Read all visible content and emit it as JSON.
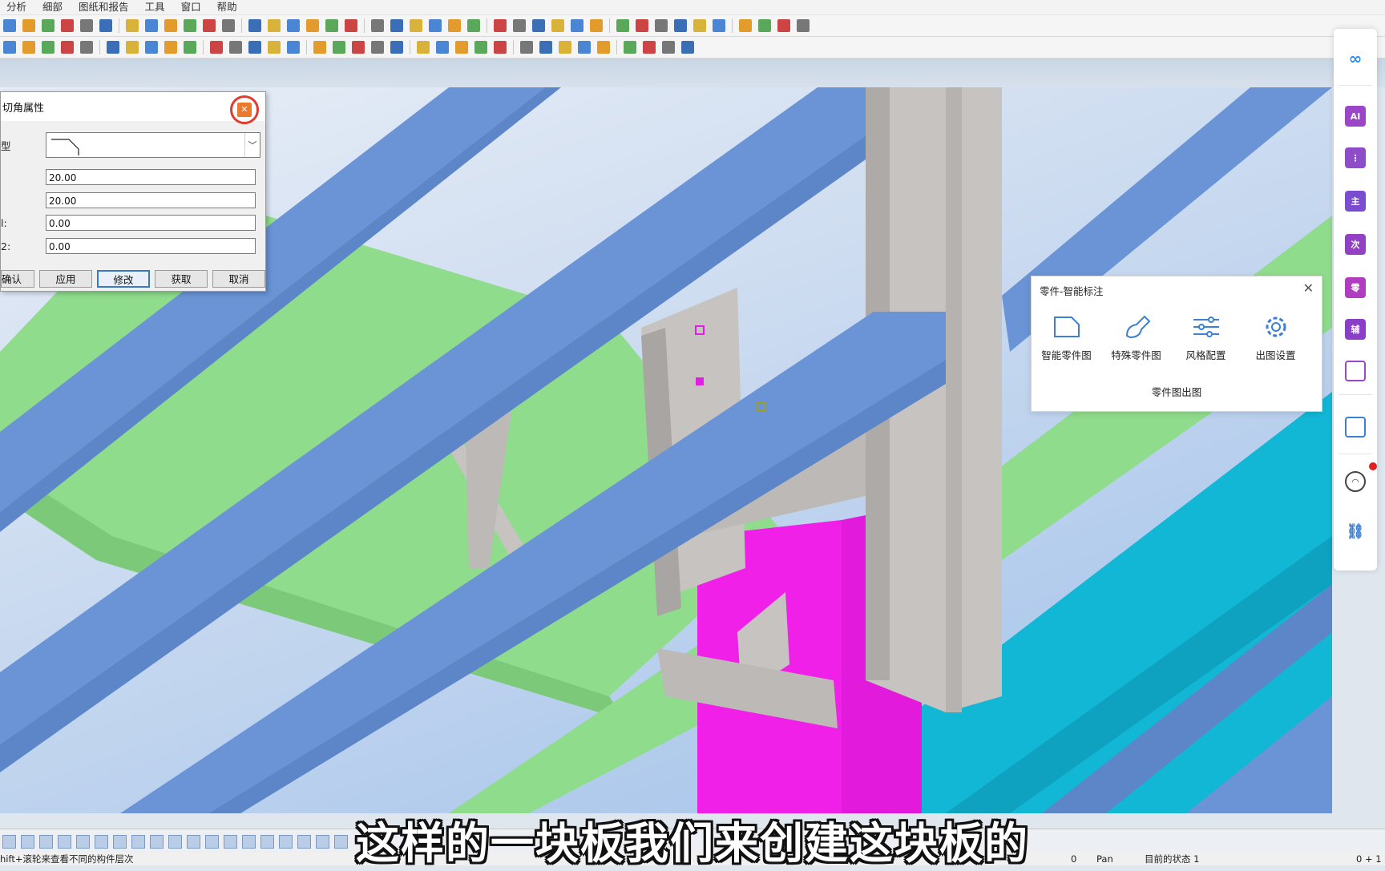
{
  "menu": [
    "分析",
    "细部",
    "图纸和报告",
    "工具",
    "窗口",
    "帮助"
  ],
  "dialog": {
    "title": "切角属性",
    "type_label": "型",
    "field1_value": "20.00",
    "field2_value": "20.00",
    "field3_label": "l:",
    "field3_value": "0.00",
    "field4_label": "2:",
    "field4_value": "0.00",
    "buttons": {
      "ok": "确认",
      "apply": "应用",
      "modify": "修改",
      "get": "获取",
      "cancel": "取消"
    }
  },
  "smart_panel": {
    "title": "零件-智能标注",
    "items": [
      {
        "label": "智能零件图",
        "icon": "part-drawing-icon"
      },
      {
        "label": "特殊零件图",
        "icon": "special-part-icon"
      },
      {
        "label": "风格配置",
        "icon": "sliders-icon"
      },
      {
        "label": "出图设置",
        "icon": "gear-icon"
      }
    ],
    "footer": "零件图出图"
  },
  "sidebar": {
    "items": [
      {
        "icon": "infinity-logo-icon",
        "text": ""
      },
      {
        "icon": "ai-drawing-icon",
        "text": "AI"
      },
      {
        "icon": "ai-flow-icon",
        "text": ""
      },
      {
        "icon": "ai-main-icon",
        "text": "主"
      },
      {
        "icon": "ai-secondary-icon",
        "text": "次"
      },
      {
        "icon": "ai-part-icon",
        "text": "零"
      },
      {
        "icon": "ai-aux-icon",
        "text": "辅"
      },
      {
        "icon": "layout-icon",
        "text": ""
      },
      {
        "icon": "grid-icon",
        "text": ""
      },
      {
        "icon": "user-icon",
        "text": ""
      },
      {
        "icon": "link-icon",
        "text": ""
      }
    ]
  },
  "status": {
    "hint": "hift+滚轮来查看不同的构件层次",
    "count": "0",
    "mode": "Pan",
    "state": "目前的状态 1",
    "selection": "0 + 1"
  },
  "subtitle": "这样的一块板我们来创建这块板的",
  "colors": {
    "beam_blue": "#6a94d6",
    "floor_green": "#8fdc8c",
    "column_grey": "#c6c3c1",
    "magenta": "#f020e8",
    "cyan": "#12b7d6",
    "close_ring": "#e23b2f",
    "panel_icon_blue": "#3b7fd6"
  }
}
